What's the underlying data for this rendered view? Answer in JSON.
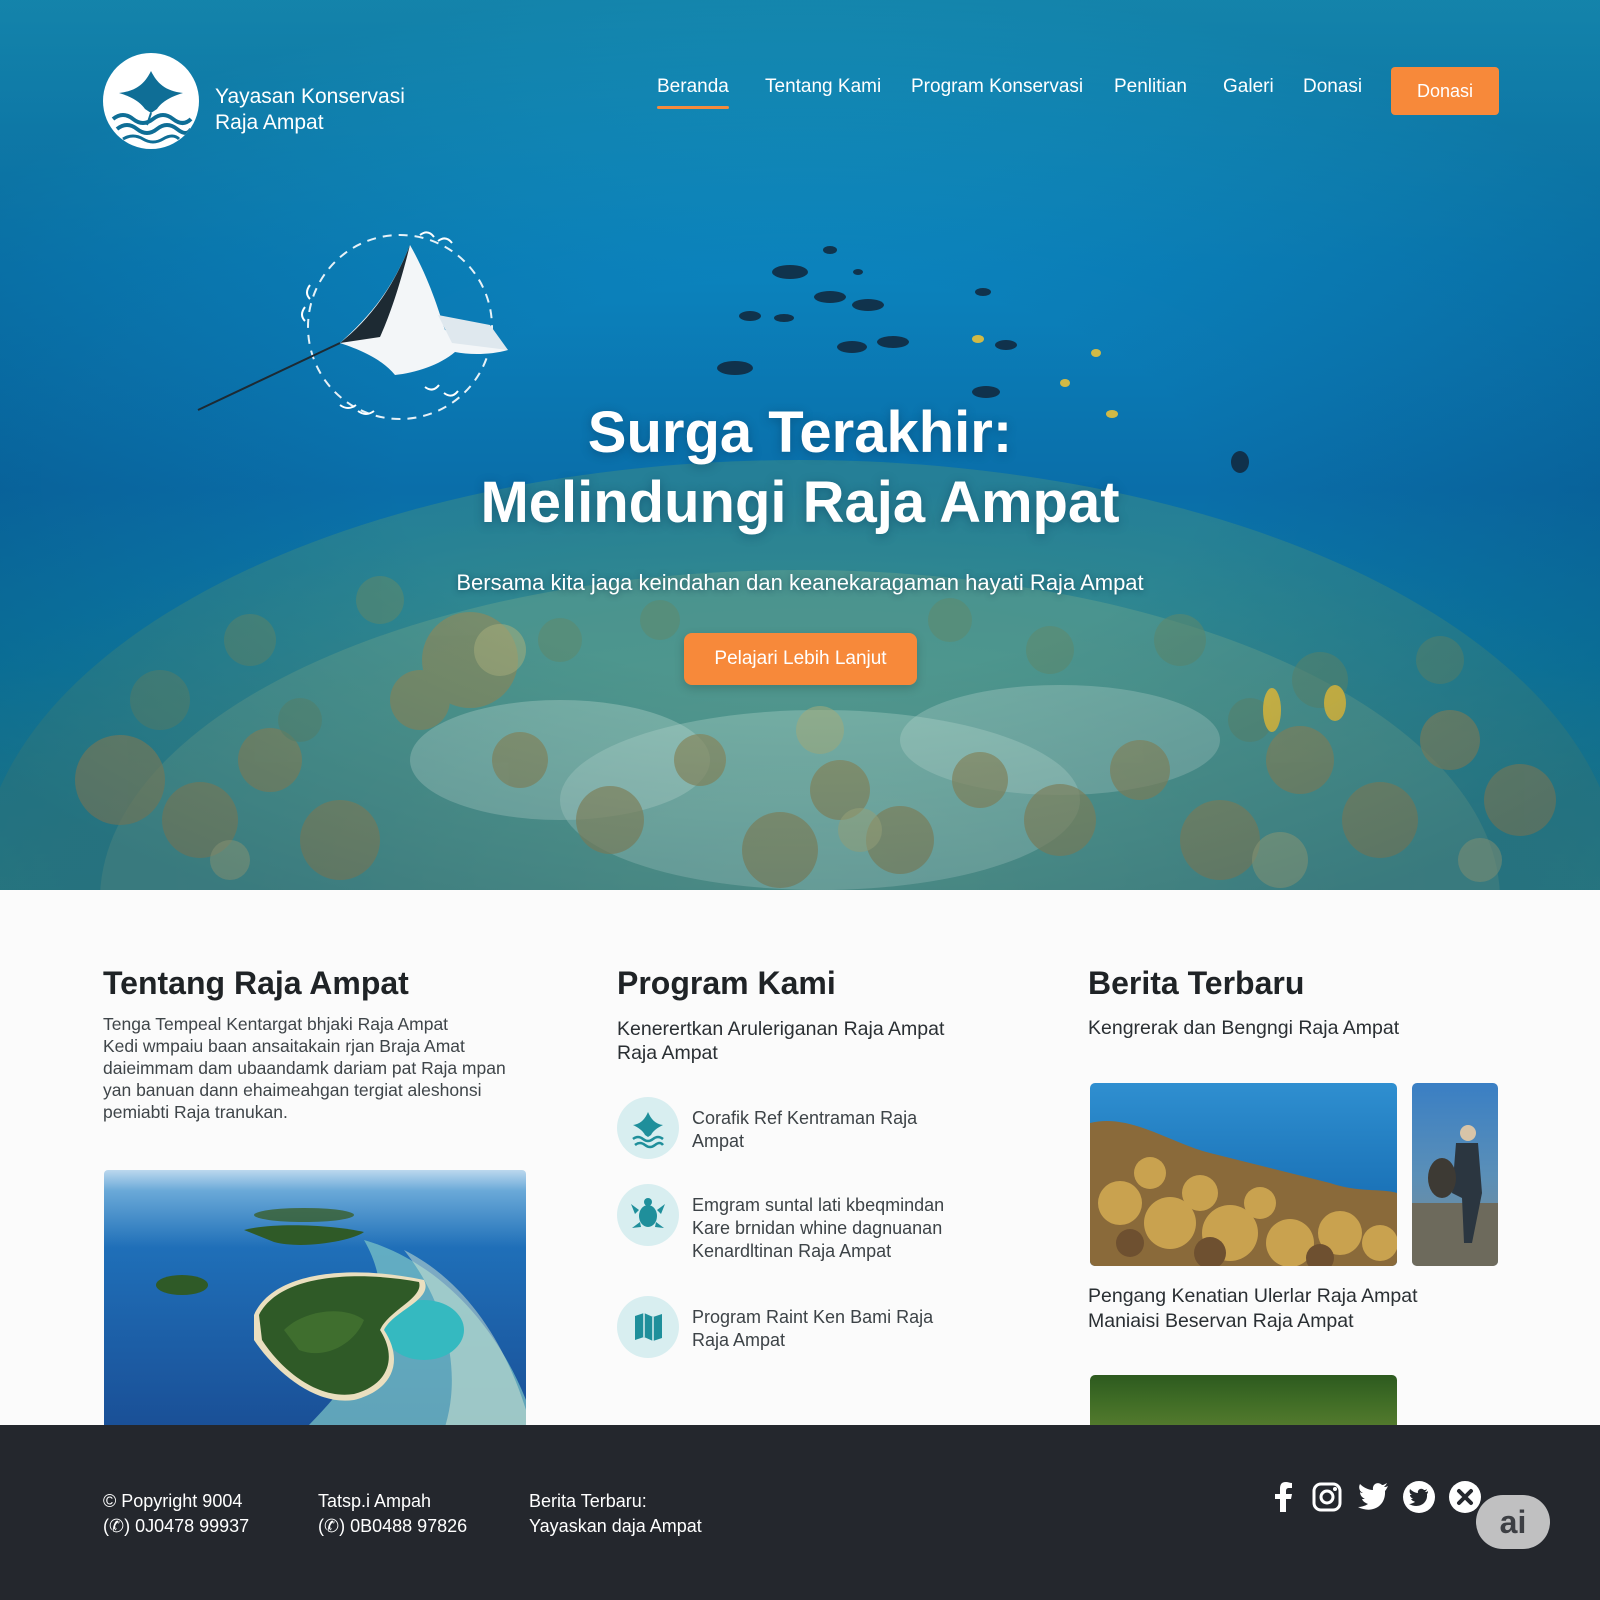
{
  "brand": {
    "line1": "Yayasan Konservasi",
    "line2": "Raja Ampat"
  },
  "nav": {
    "items": [
      {
        "label": "Beranda",
        "active": true
      },
      {
        "label": "Tentang Kami"
      },
      {
        "label": "Program Konservasi"
      },
      {
        "label": "Penlitian"
      },
      {
        "label": "Galeri"
      },
      {
        "label": "Donasi"
      }
    ],
    "donate_button": "Donasi"
  },
  "hero": {
    "title_line1": "Surga Terakhir:",
    "title_line2": "Melindungi Raja Ampat",
    "subtitle": "Bersama kita jaga keindahan dan keanekaragaman hayati Raja Ampat",
    "cta": "Pelajari Lebih Lanjut"
  },
  "about": {
    "title": "Tentang Raja Ampat",
    "lines": [
      "Tenga Tempeal Kentargat bhjaki Raja Ampat",
      "Kedi wmpaiu baan ansaitakain rjan Braja Amat",
      "daieimmam dam ubaandamk dariam pat Raja mpan",
      "yan banuan dann ehaimeahgan tergiat aleshonsi",
      "pemiabti Raja tranukan."
    ]
  },
  "programs": {
    "title": "Program Kami",
    "subtitle_line1": "Kenerertkan Aruleriganan Raja Ampat",
    "subtitle_line2": "Raja Ampat",
    "items": [
      {
        "icon": "manta-ray-icon",
        "lines": [
          "Corafik Ref Kentraman Raja",
          "Ampat"
        ]
      },
      {
        "icon": "turtle-icon",
        "lines": [
          "Emgram suntal lati kbeqmindan",
          "Kare brnidan whine dagnuanan",
          "Kenardltinan Raja Ampat"
        ]
      },
      {
        "icon": "map-icon",
        "lines": [
          "Program Raint Ken Bami Raja",
          "Raja Ampat"
        ]
      }
    ]
  },
  "news": {
    "title": "Berita Terbaru",
    "subtitle": "Kengrerak dan Bengngi Raja Ampat",
    "caption_line1": "Pengang Kenatian Ulerlar Raja Ampat",
    "caption_line2": "Maniaisi Beservan Raja Ampat"
  },
  "footer": {
    "col1": [
      "© Popyright 9004",
      "(✆) 0J0478 99937"
    ],
    "col2": [
      "Tatsp.i Ampah",
      "(✆) 0B0488 97826"
    ],
    "col3": [
      "Berita Terbaru:",
      "Yayaskan daja Ampat"
    ],
    "socials": [
      "facebook-icon",
      "instagram-icon",
      "twitter-icon",
      "twitter-circle-icon",
      "close-circle-icon"
    ],
    "badge": "ai"
  },
  "colors": {
    "accent": "#f7893a",
    "footer_bg": "#24272d",
    "hero_blue": "#0b83bd",
    "icon_bg": "#d8eef0",
    "icon_fg": "#1f8f9b"
  }
}
